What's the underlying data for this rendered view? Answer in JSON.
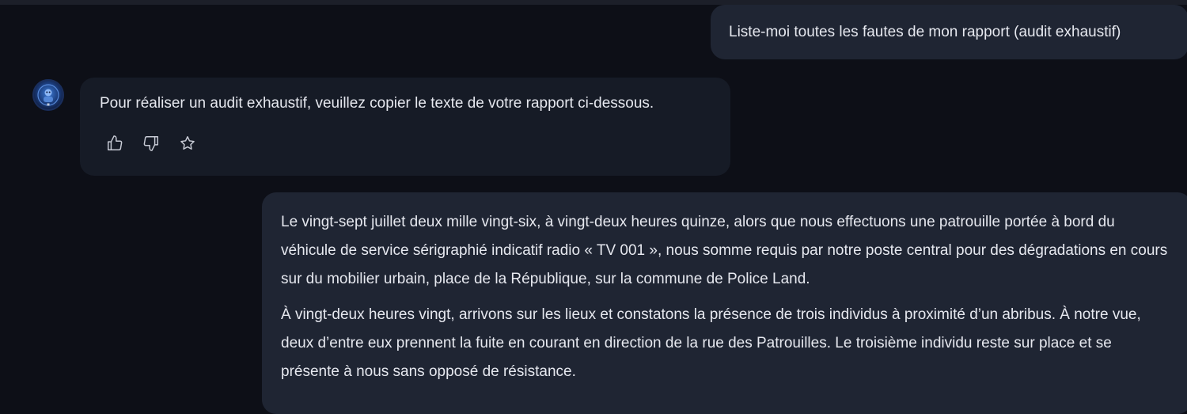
{
  "conversation": {
    "user_message_1": "Liste-moi toutes les fautes de mon rapport (audit exhaustif)",
    "assistant_message_1": "Pour réaliser un audit exhaustif, veuillez copier le texte de votre rapport ci-dessous.",
    "assistant_actions": {
      "like_icon": "thumbs-up-icon",
      "dislike_icon": "thumbs-down-icon",
      "favorite_icon": "star-icon"
    },
    "user_message_2": {
      "paragraphs": [
        "Le vingt-sept juillet deux mille vingt-six, à vingt-deux heures quinze, alors que nous effectuons une patrouille portée à bord du véhicule de service sérigraphié indicatif radio « TV 001 », nous somme requis par notre poste central pour des dégradations en cours sur du mobilier urbain, place de la République, sur la commune de Police Land.",
        "À vingt-deux heures vingt, arrivons sur les lieux et constatons la présence de trois individus à proximité d’un abribus. À notre vue, deux d’entre eux prennent la fuite en courant en direction de la rue des Patrouilles. Le troisième individu reste sur place et se présente à nous sans opposé de résistance."
      ]
    }
  },
  "colors": {
    "background": "#0d0f17",
    "user_bubble": "#1f2533",
    "assistant_bubble": "#161b26",
    "text": "#e6e8ef"
  }
}
